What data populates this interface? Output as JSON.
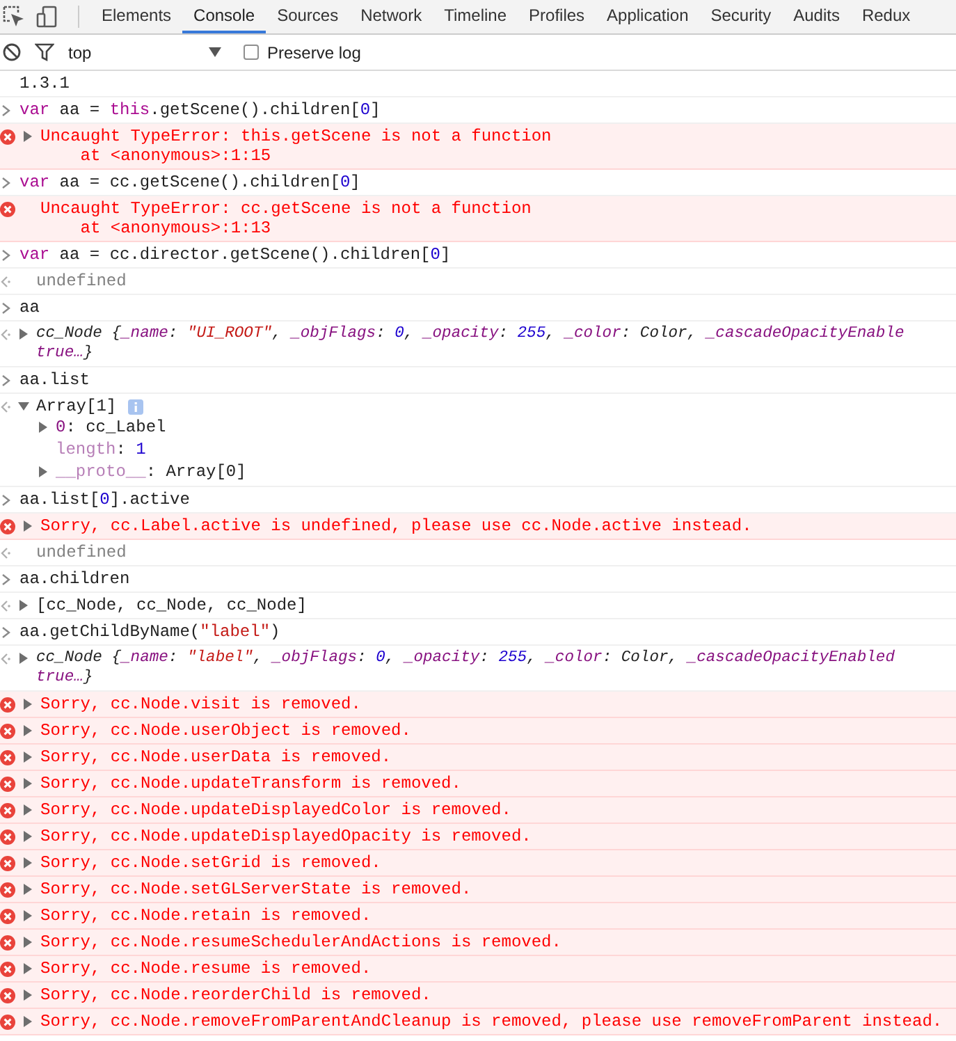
{
  "tabs": [
    {
      "label": "Elements",
      "selected": false
    },
    {
      "label": "Console",
      "selected": true
    },
    {
      "label": "Sources",
      "selected": false
    },
    {
      "label": "Network",
      "selected": false
    },
    {
      "label": "Timeline",
      "selected": false
    },
    {
      "label": "Profiles",
      "selected": false
    },
    {
      "label": "Application",
      "selected": false
    },
    {
      "label": "Security",
      "selected": false
    },
    {
      "label": "Audits",
      "selected": false
    },
    {
      "label": "Redux",
      "selected": false
    }
  ],
  "toolbar": {
    "context": "top",
    "preserve_log": {
      "label": "Preserve log",
      "checked": false
    }
  },
  "entries": [
    {
      "kind": "log",
      "tokens": [
        {
          "text": "1.3.1",
          "kind": "plain"
        }
      ]
    },
    {
      "kind": "input",
      "tokens": [
        {
          "text": "var",
          "kind": "keyword"
        },
        {
          "text": " aa = ",
          "kind": "plain"
        },
        {
          "text": "this",
          "kind": "keyword"
        },
        {
          "text": ".getScene().children[",
          "kind": "plain"
        },
        {
          "text": "0",
          "kind": "number"
        },
        {
          "text": "]",
          "kind": "plain"
        }
      ]
    },
    {
      "kind": "error",
      "expandable": true,
      "lines": [
        "Uncaught TypeError: this.getScene is not a function",
        "    at <anonymous>:1:15"
      ]
    },
    {
      "kind": "input",
      "tokens": [
        {
          "text": "var",
          "kind": "keyword"
        },
        {
          "text": " aa = cc.getScene().children[",
          "kind": "plain"
        },
        {
          "text": "0",
          "kind": "number"
        },
        {
          "text": "]",
          "kind": "plain"
        }
      ]
    },
    {
      "kind": "error",
      "expandable": false,
      "lines": [
        "Uncaught TypeError: cc.getScene is not a function",
        "    at <anonymous>:1:13"
      ]
    },
    {
      "kind": "input",
      "tokens": [
        {
          "text": "var",
          "kind": "keyword"
        },
        {
          "text": " aa = cc.director.getScene().children[",
          "kind": "plain"
        },
        {
          "text": "0",
          "kind": "number"
        },
        {
          "text": "]",
          "kind": "plain"
        }
      ]
    },
    {
      "kind": "result",
      "tokens": [
        {
          "text": "undefined",
          "kind": "undefined"
        }
      ]
    },
    {
      "kind": "input",
      "tokens": [
        {
          "text": "aa",
          "kind": "plain"
        }
      ]
    },
    {
      "kind": "result",
      "expandable": true,
      "expanded": false,
      "italic": true,
      "tokens": [
        {
          "text": "cc_Node {",
          "kind": "plain"
        },
        {
          "text": "_name",
          "kind": "key"
        },
        {
          "text": ": ",
          "kind": "plain"
        },
        {
          "text": "\"UI_ROOT\"",
          "kind": "string"
        },
        {
          "text": ", ",
          "kind": "plain"
        },
        {
          "text": "_objFlags",
          "kind": "key"
        },
        {
          "text": ": ",
          "kind": "plain"
        },
        {
          "text": "0",
          "kind": "number"
        },
        {
          "text": ", ",
          "kind": "plain"
        },
        {
          "text": "_opacity",
          "kind": "key"
        },
        {
          "text": ": ",
          "kind": "plain"
        },
        {
          "text": "255",
          "kind": "number"
        },
        {
          "text": ", ",
          "kind": "plain"
        },
        {
          "text": "_color",
          "kind": "key"
        },
        {
          "text": ": Color, ",
          "kind": "plain"
        },
        {
          "text": "_cascadeOpacityEnable",
          "kind": "key"
        }
      ],
      "more": [
        {
          "text": "true…",
          "kind": "key"
        },
        {
          "text": "}",
          "kind": "plain"
        }
      ]
    },
    {
      "kind": "input",
      "tokens": [
        {
          "text": "aa.list",
          "kind": "plain"
        }
      ]
    },
    {
      "kind": "result",
      "expandable": true,
      "expanded": true,
      "info": true,
      "tokens": [
        {
          "text": "Array[1]",
          "kind": "plain"
        }
      ],
      "children": [
        {
          "expandable": true,
          "expanded": false,
          "tokens": [
            {
              "text": "0",
              "kind": "key"
            },
            {
              "text": ": cc_Label",
              "kind": "plain"
            }
          ]
        },
        {
          "expandable": false,
          "tokens": [
            {
              "text": "length",
              "kind": "dim_key"
            },
            {
              "text": ": ",
              "kind": "plain"
            },
            {
              "text": "1",
              "kind": "number"
            }
          ]
        },
        {
          "expandable": true,
          "expanded": false,
          "tokens": [
            {
              "text": "__proto__",
              "kind": "dim_key"
            },
            {
              "text": ": Array[0]",
              "kind": "plain"
            }
          ]
        }
      ]
    },
    {
      "kind": "input",
      "tokens": [
        {
          "text": "aa.list[",
          "kind": "plain"
        },
        {
          "text": "0",
          "kind": "number"
        },
        {
          "text": "].active",
          "kind": "plain"
        }
      ]
    },
    {
      "kind": "error",
      "expandable": true,
      "lines": [
        "Sorry, cc.Label.active is undefined, please use cc.Node.active instead."
      ]
    },
    {
      "kind": "result",
      "tokens": [
        {
          "text": "undefined",
          "kind": "undefined"
        }
      ]
    },
    {
      "kind": "input",
      "tokens": [
        {
          "text": "aa.children",
          "kind": "plain"
        }
      ]
    },
    {
      "kind": "result",
      "expandable": true,
      "expanded": false,
      "tokens": [
        {
          "text": "[cc_Node, cc_Node, cc_Node]",
          "kind": "plain"
        }
      ]
    },
    {
      "kind": "input",
      "tokens": [
        {
          "text": "aa.getChildByName(",
          "kind": "plain"
        },
        {
          "text": "\"label\"",
          "kind": "string"
        },
        {
          "text": ")",
          "kind": "plain"
        }
      ]
    },
    {
      "kind": "result",
      "expandable": true,
      "expanded": false,
      "italic": true,
      "tokens": [
        {
          "text": "cc_Node {",
          "kind": "plain"
        },
        {
          "text": "_name",
          "kind": "key"
        },
        {
          "text": ": ",
          "kind": "plain"
        },
        {
          "text": "\"label\"",
          "kind": "string"
        },
        {
          "text": ", ",
          "kind": "plain"
        },
        {
          "text": "_objFlags",
          "kind": "key"
        },
        {
          "text": ": ",
          "kind": "plain"
        },
        {
          "text": "0",
          "kind": "number"
        },
        {
          "text": ", ",
          "kind": "plain"
        },
        {
          "text": "_opacity",
          "kind": "key"
        },
        {
          "text": ": ",
          "kind": "plain"
        },
        {
          "text": "255",
          "kind": "number"
        },
        {
          "text": ", ",
          "kind": "plain"
        },
        {
          "text": "_color",
          "kind": "key"
        },
        {
          "text": ": Color, ",
          "kind": "plain"
        },
        {
          "text": "_cascadeOpacityEnabled",
          "kind": "key"
        }
      ],
      "more": [
        {
          "text": "true…",
          "kind": "key"
        },
        {
          "text": "}",
          "kind": "plain"
        }
      ]
    },
    {
      "kind": "error",
      "expandable": true,
      "lines": [
        "Sorry, cc.Node.visit is removed."
      ]
    },
    {
      "kind": "error",
      "expandable": true,
      "lines": [
        "Sorry, cc.Node.userObject is removed."
      ]
    },
    {
      "kind": "error",
      "expandable": true,
      "lines": [
        "Sorry, cc.Node.userData is removed."
      ]
    },
    {
      "kind": "error",
      "expandable": true,
      "lines": [
        "Sorry, cc.Node.updateTransform is removed."
      ]
    },
    {
      "kind": "error",
      "expandable": true,
      "lines": [
        "Sorry, cc.Node.updateDisplayedColor is removed."
      ]
    },
    {
      "kind": "error",
      "expandable": true,
      "lines": [
        "Sorry, cc.Node.updateDisplayedOpacity is removed."
      ]
    },
    {
      "kind": "error",
      "expandable": true,
      "lines": [
        "Sorry, cc.Node.setGrid is removed."
      ]
    },
    {
      "kind": "error",
      "expandable": true,
      "lines": [
        "Sorry, cc.Node.setGLServerState is removed."
      ]
    },
    {
      "kind": "error",
      "expandable": true,
      "lines": [
        "Sorry, cc.Node.retain is removed."
      ]
    },
    {
      "kind": "error",
      "expandable": true,
      "lines": [
        "Sorry, cc.Node.resumeSchedulerAndActions is removed."
      ]
    },
    {
      "kind": "error",
      "expandable": true,
      "lines": [
        "Sorry, cc.Node.resume is removed."
      ]
    },
    {
      "kind": "error",
      "expandable": true,
      "lines": [
        "Sorry, cc.Node.reorderChild is removed."
      ]
    },
    {
      "kind": "error",
      "expandable": true,
      "lines": [
        "Sorry, cc.Node.removeFromParentAndCleanup is removed, please use removeFromParent instead."
      ]
    }
  ]
}
